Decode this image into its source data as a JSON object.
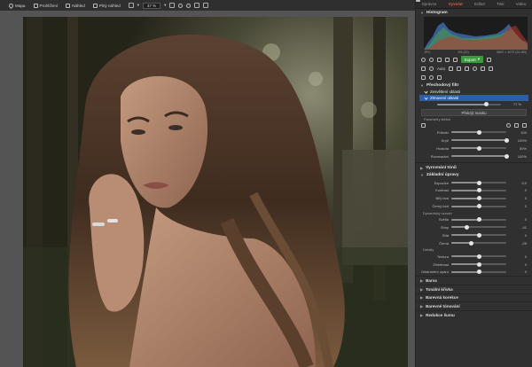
{
  "toolbar": {
    "items": [
      {
        "label": "Mapa",
        "icon": "map-pin-icon"
      },
      {
        "label": "Prohlížení",
        "icon": "grid-icon"
      },
      {
        "label": "Náhled",
        "icon": "preview-icon"
      },
      {
        "label": "Plný náhled",
        "icon": "fullscreen-icon"
      }
    ],
    "zoom": "47 %"
  },
  "modes": {
    "tabs": [
      "Správce",
      "Vyvolat",
      "Editor",
      "Tisk",
      "Video"
    ],
    "active": "Vyvolat"
  },
  "histogram": {
    "title": "Histogram",
    "format": "JPG",
    "index": "2/9 (22)",
    "dimensions": "5892 × 4072 (24 MB)"
  },
  "toolbox": {
    "export_label": "Export",
    "auto_label": "Auto"
  },
  "gradient_filter": {
    "title": "Přechodový filtr",
    "layers": [
      {
        "name": "Zesvětlení oblasti",
        "selected": false
      },
      {
        "name": "Ztmavení oblasti",
        "selected": true
      }
    ],
    "opacity_label": "77 %",
    "opacity_fraction": 0.77,
    "mask_button": "Překrýt masku",
    "brush_params_label": "Parametry štětce",
    "brush": [
      {
        "label": "Průměr",
        "value": "100",
        "fraction": 0.5
      },
      {
        "label": "Krytí",
        "value": "100%",
        "fraction": 1.0
      },
      {
        "label": "Hustota",
        "value": "50%",
        "fraction": 0.5
      },
      {
        "label": "Rozmazání",
        "value": "100%",
        "fraction": 1.0
      }
    ]
  },
  "sections": {
    "vignette": "Vyrovnání tónů",
    "basic": "Základní úpravy"
  },
  "basic": {
    "light": [
      {
        "label": "Expozice",
        "value": "0,0",
        "fraction": 0.5
      },
      {
        "label": "Kontrast",
        "value": "0",
        "fraction": 0.5
      },
      {
        "label": "Bílý bod",
        "value": "0",
        "fraction": 0.5
      },
      {
        "label": "Černý bod",
        "value": "0",
        "fraction": 0.5
      }
    ],
    "dynamic_label": "Dynamický rozsah",
    "dynamic": [
      {
        "label": "Světla",
        "value": "0",
        "fraction": 0.5
      },
      {
        "label": "Stíny",
        "value": "-41",
        "fraction": 0.29
      }
    ],
    "color_group": [
      {
        "label": "Bílá",
        "value": "0",
        "fraction": 0.5
      },
      {
        "label": "Černá",
        "value": "-25",
        "fraction": 0.37
      }
    ],
    "details_label": "Detaily",
    "details": [
      {
        "label": "Textura",
        "value": "0",
        "fraction": 0.5
      },
      {
        "label": "Zřetelnost",
        "value": "0",
        "fraction": 0.5
      },
      {
        "label": "Odstranění oparu",
        "value": "0",
        "fraction": 0.5
      }
    ]
  },
  "collapsed_sections": [
    "Barva",
    "Tonální křivka",
    "Barevná korekce",
    "Barevné tónování",
    "Redukce šumu"
  ]
}
